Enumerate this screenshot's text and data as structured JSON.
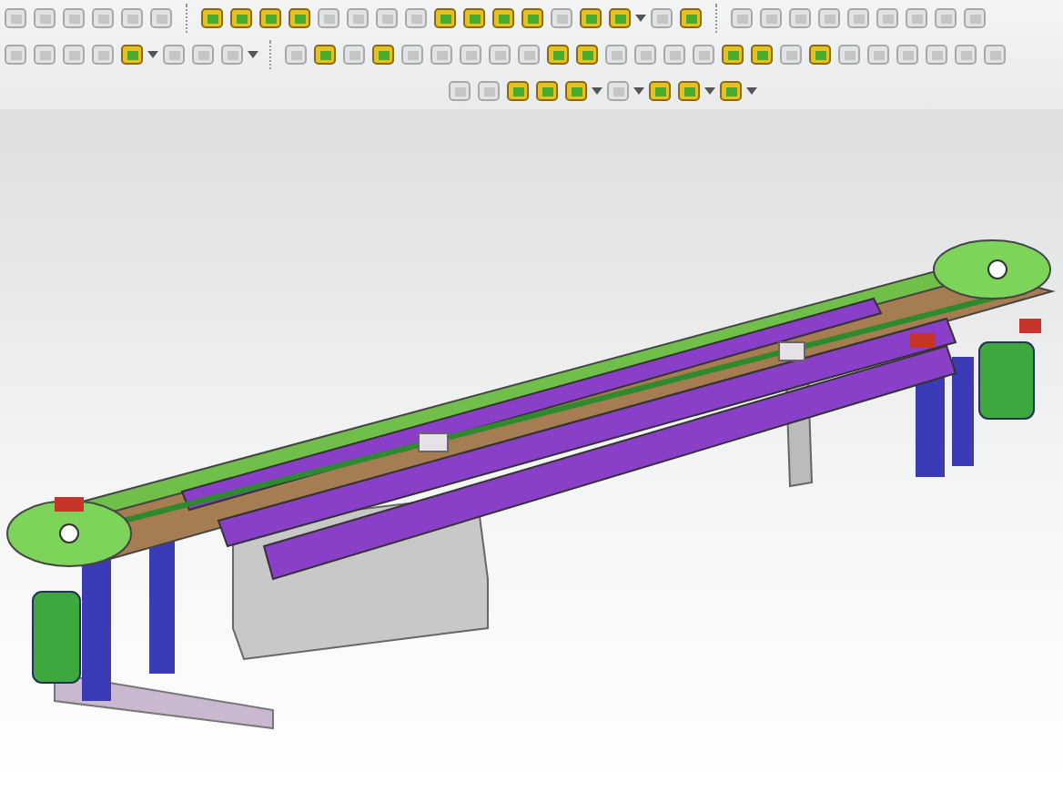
{
  "toolbars": [
    {
      "groups": [
        [
          {
            "disabled": true,
            "dropdown": false
          },
          {
            "disabled": true,
            "dropdown": false
          },
          {
            "disabled": true,
            "dropdown": false
          },
          {
            "disabled": true,
            "dropdown": false
          },
          {
            "disabled": true,
            "dropdown": false
          },
          {
            "disabled": true,
            "dropdown": false
          }
        ],
        [
          {
            "disabled": false,
            "dropdown": false
          },
          {
            "disabled": false,
            "dropdown": false
          },
          {
            "disabled": false,
            "dropdown": false
          },
          {
            "disabled": false,
            "dropdown": false
          },
          {
            "disabled": true,
            "dropdown": false
          },
          {
            "disabled": true,
            "dropdown": false
          },
          {
            "disabled": true,
            "dropdown": false
          },
          {
            "disabled": true,
            "dropdown": false
          },
          {
            "disabled": false,
            "dropdown": false
          },
          {
            "disabled": false,
            "dropdown": false
          },
          {
            "disabled": false,
            "dropdown": false
          },
          {
            "disabled": false,
            "dropdown": false
          },
          {
            "disabled": true,
            "dropdown": false
          },
          {
            "disabled": false,
            "dropdown": false
          },
          {
            "disabled": false,
            "dropdown": true
          },
          {
            "disabled": true,
            "dropdown": false
          },
          {
            "disabled": false,
            "dropdown": false
          }
        ],
        [
          {
            "disabled": true,
            "dropdown": false
          },
          {
            "disabled": true,
            "dropdown": false
          },
          {
            "disabled": true,
            "dropdown": false
          },
          {
            "disabled": true,
            "dropdown": false
          },
          {
            "disabled": true,
            "dropdown": false
          },
          {
            "disabled": true,
            "dropdown": false
          },
          {
            "disabled": true,
            "dropdown": false
          },
          {
            "disabled": true,
            "dropdown": false
          },
          {
            "disabled": true,
            "dropdown": false
          }
        ]
      ]
    },
    {
      "groups": [
        [
          {
            "disabled": true,
            "dropdown": false
          },
          {
            "disabled": true,
            "dropdown": false
          },
          {
            "disabled": true,
            "dropdown": false
          },
          {
            "disabled": true,
            "dropdown": false
          },
          {
            "disabled": false,
            "dropdown": true
          },
          {
            "disabled": true,
            "dropdown": false
          },
          {
            "disabled": true,
            "dropdown": false
          },
          {
            "disabled": true,
            "dropdown": true
          }
        ],
        [
          {
            "disabled": true,
            "dropdown": false
          },
          {
            "disabled": false,
            "dropdown": false
          },
          {
            "disabled": true,
            "dropdown": false
          },
          {
            "disabled": false,
            "dropdown": false
          },
          {
            "disabled": true,
            "dropdown": false
          },
          {
            "disabled": true,
            "dropdown": false
          },
          {
            "disabled": true,
            "dropdown": false
          },
          {
            "disabled": true,
            "dropdown": false
          },
          {
            "disabled": true,
            "dropdown": false
          },
          {
            "disabled": false,
            "dropdown": false
          },
          {
            "disabled": false,
            "dropdown": false
          },
          {
            "disabled": true,
            "dropdown": false
          },
          {
            "disabled": true,
            "dropdown": false
          },
          {
            "disabled": true,
            "dropdown": false
          },
          {
            "disabled": true,
            "dropdown": false
          },
          {
            "disabled": false,
            "dropdown": false
          },
          {
            "disabled": false,
            "dropdown": false
          },
          {
            "disabled": true,
            "dropdown": false
          },
          {
            "disabled": false,
            "dropdown": false
          },
          {
            "disabled": true,
            "dropdown": false
          },
          {
            "disabled": true,
            "dropdown": false
          },
          {
            "disabled": true,
            "dropdown": false
          },
          {
            "disabled": true,
            "dropdown": false
          },
          {
            "disabled": true,
            "dropdown": false
          },
          {
            "disabled": true,
            "dropdown": false
          }
        ]
      ]
    },
    {
      "groups": [
        [
          {
            "disabled": true,
            "dropdown": false
          },
          {
            "disabled": true,
            "dropdown": false
          },
          {
            "disabled": false,
            "dropdown": false
          },
          {
            "disabled": false,
            "dropdown": false
          },
          {
            "disabled": false,
            "dropdown": true
          },
          {
            "disabled": true,
            "dropdown": true
          },
          {
            "disabled": false,
            "dropdown": false
          },
          {
            "disabled": false,
            "dropdown": true
          },
          {
            "disabled": false,
            "dropdown": true
          }
        ]
      ]
    }
  ]
}
